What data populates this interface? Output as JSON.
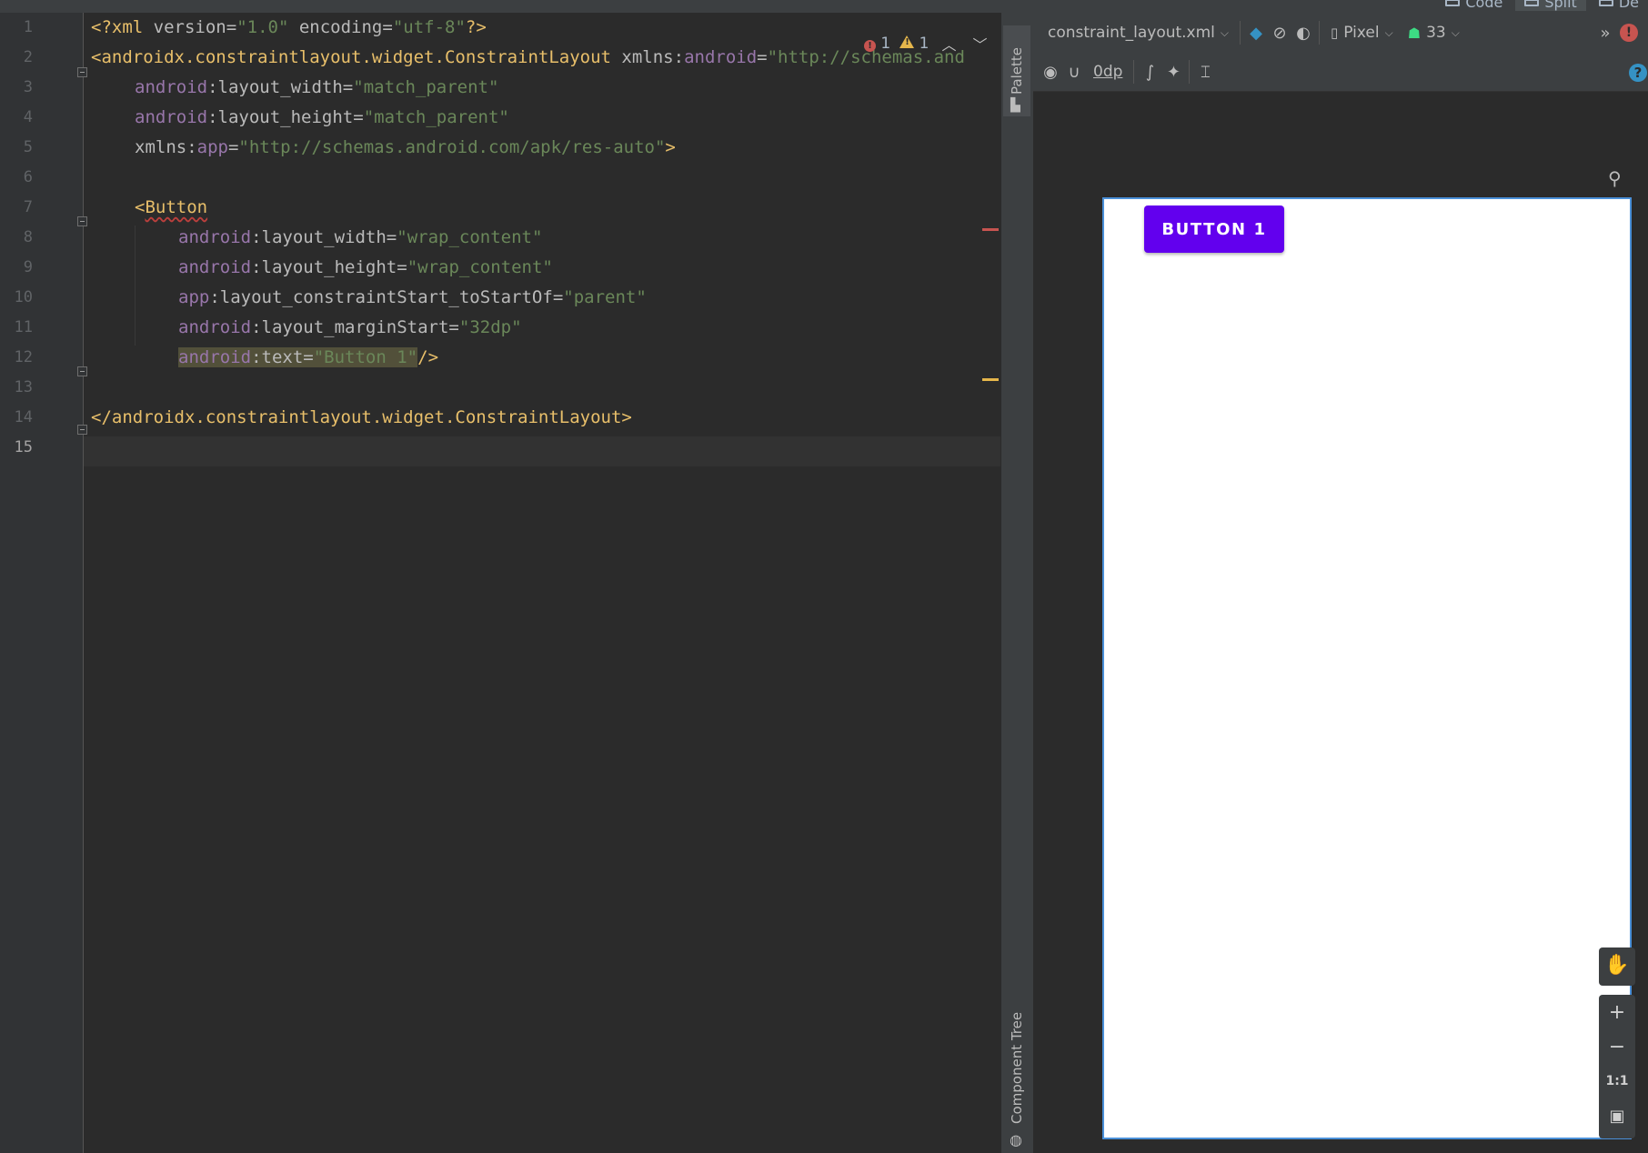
{
  "view_modes": [
    "Code",
    "Split",
    "De"
  ],
  "editor": {
    "current_line": 15,
    "lines": [
      {
        "n": "1",
        "indent": 0,
        "tokens": [
          [
            "pun",
            "<?"
          ],
          [
            "tag",
            "xml"
          ],
          [
            "plain",
            " "
          ],
          [
            "attr",
            "version"
          ],
          [
            "eq",
            "="
          ],
          [
            "val",
            "\"1.0\""
          ],
          [
            "plain",
            " "
          ],
          [
            "attr",
            "encoding"
          ],
          [
            "eq",
            "="
          ],
          [
            "val",
            "\"utf-8\""
          ],
          [
            "pun",
            "?>"
          ]
        ]
      },
      {
        "n": "2",
        "indent": 0,
        "tokens": [
          [
            "pun",
            "<"
          ],
          [
            "tag",
            "androidx.constraintlayout.widget.ConstraintLayout"
          ],
          [
            "plain",
            " "
          ],
          [
            "attr",
            "xmlns:"
          ],
          [
            "ns",
            "android"
          ],
          [
            "eq",
            "="
          ],
          [
            "val",
            "\"http://schemas.and"
          ]
        ]
      },
      {
        "n": "3",
        "indent": 1,
        "tokens": [
          [
            "ns",
            "android"
          ],
          [
            "attr",
            ":layout_width"
          ],
          [
            "eq",
            "="
          ],
          [
            "val",
            "\"match_parent\""
          ]
        ]
      },
      {
        "n": "4",
        "indent": 1,
        "tokens": [
          [
            "ns",
            "android"
          ],
          [
            "attr",
            ":layout_height"
          ],
          [
            "eq",
            "="
          ],
          [
            "val",
            "\"match_parent\""
          ]
        ]
      },
      {
        "n": "5",
        "indent": 1,
        "tokens": [
          [
            "attr",
            "xmlns:"
          ],
          [
            "ns",
            "app"
          ],
          [
            "eq",
            "="
          ],
          [
            "val",
            "\"http://schemas.android.com/apk/res-auto\""
          ],
          [
            "pun",
            ">"
          ]
        ]
      },
      {
        "n": "6",
        "indent": 0,
        "tokens": []
      },
      {
        "n": "7",
        "indent": 1,
        "tokens": [
          [
            "pun",
            "<"
          ],
          [
            "tag err",
            "Button"
          ]
        ]
      },
      {
        "n": "8",
        "indent": 2,
        "tokens": [
          [
            "ns",
            "android"
          ],
          [
            "attr",
            ":layout_width"
          ],
          [
            "eq",
            "="
          ],
          [
            "val",
            "\"wrap_content\""
          ]
        ]
      },
      {
        "n": "9",
        "indent": 2,
        "tokens": [
          [
            "ns",
            "android"
          ],
          [
            "attr",
            ":layout_height"
          ],
          [
            "eq",
            "="
          ],
          [
            "val",
            "\"wrap_content\""
          ]
        ]
      },
      {
        "n": "10",
        "indent": 2,
        "tokens": [
          [
            "ns",
            "app"
          ],
          [
            "attr",
            ":layout_constraintStart_toStartOf"
          ],
          [
            "eq",
            "="
          ],
          [
            "val",
            "\"parent\""
          ]
        ]
      },
      {
        "n": "11",
        "indent": 2,
        "tokens": [
          [
            "ns",
            "android"
          ],
          [
            "attr",
            ":layout_marginStart"
          ],
          [
            "eq",
            "="
          ],
          [
            "val",
            "\"32dp\""
          ]
        ]
      },
      {
        "n": "12",
        "indent": 2,
        "tokens": [
          [
            "ns hl",
            "android"
          ],
          [
            "attr hl",
            ":text"
          ],
          [
            "eq hl",
            "="
          ],
          [
            "val hl",
            "\"Button 1\""
          ],
          [
            "pun",
            "/>"
          ]
        ]
      },
      {
        "n": "13",
        "indent": 0,
        "tokens": []
      },
      {
        "n": "14",
        "indent": 0,
        "tokens": [
          [
            "pun",
            "</"
          ],
          [
            "tag",
            "androidx.constraintlayout.widget.ConstraintLayout"
          ],
          [
            "pun",
            ">"
          ]
        ]
      },
      {
        "n": "15",
        "indent": 0,
        "tokens": []
      }
    ]
  },
  "inspections": {
    "errors": "1",
    "warnings": "1"
  },
  "side_tabs": {
    "palette": "Palette",
    "component_tree": "Component Tree"
  },
  "design_toolbar": {
    "file": "constraint_layout.xml",
    "device": "Pixel",
    "api": "33",
    "default_margin": "0dp"
  },
  "preview": {
    "button_text": "BUTTON 1"
  },
  "zoom": {
    "zoom_in": "+",
    "zoom_out": "−",
    "actual_size": "1:1"
  },
  "colors": {
    "accent_button": "#6200ee",
    "error": "#c75450",
    "warning": "#e5b64b",
    "selection_border": "#4a90d9"
  }
}
